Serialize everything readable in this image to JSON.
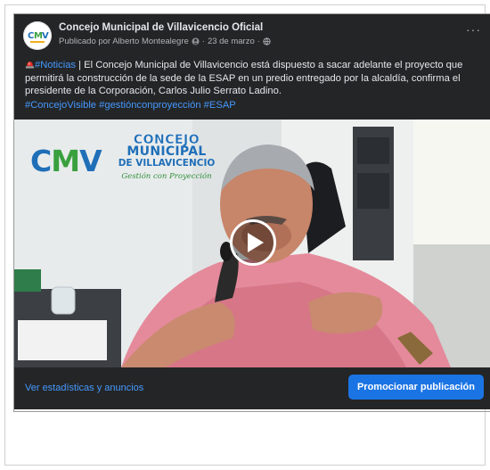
{
  "post": {
    "page_name": "Concejo Municipal de Villavicencio Oficial",
    "avatar_label": "CMV",
    "author_line": "Publicado por Alberto Montealegre",
    "date": "23 de marzo",
    "body_prefix_tag": "#Noticias",
    "body_text": " | El Concejo Municipal de Villavicencio está dispuesto a sacar adelante el proyecto que permitirá la construcción de la sede de la ESAP en un predio entregado por la alcaldía, confirma el presidente de la Corporación, Carlos Julio Serrato Ladino.",
    "hashtags": "#ConcejoVisible #gestiónconproyección #ESAP"
  },
  "video": {
    "logo_letters": [
      "C",
      "M",
      "V"
    ],
    "logo_line1": "CONCEJO",
    "logo_line2": "MUNICIPAL",
    "logo_line3": "DE VILLAVICENCIO",
    "logo_slogan": "Gestión con Proyección"
  },
  "footer": {
    "stats_link": "Ver estadísticas y anuncios",
    "promote_button": "Promocionar publicación"
  },
  "colors": {
    "card_bg": "#242526",
    "link_blue": "#4599ff",
    "button_blue": "#1b74e4",
    "logo_green": "#3aa03f",
    "logo_blue": "#1f6fb8"
  }
}
